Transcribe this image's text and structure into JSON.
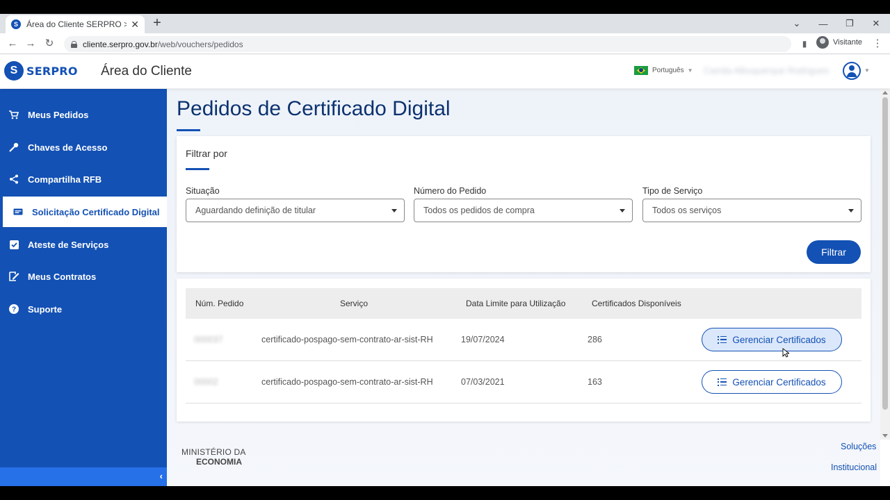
{
  "browser": {
    "tab_title": "Área do Cliente SERPRO > Pedidos",
    "url_host": "cliente.serpro.gov.br",
    "url_path": "/web/vouchers/pedidos",
    "profile_label": "Visitante"
  },
  "header": {
    "logo_mark": "S",
    "logo_text": "SERPRO",
    "app_title": "Área do Cliente",
    "language": "Português",
    "user_name": "Camila Albuquerque Rodrigues"
  },
  "sidebar": {
    "items": [
      {
        "label": "Meus Pedidos",
        "icon": "cart-icon"
      },
      {
        "label": "Chaves de Acesso",
        "icon": "key-icon"
      },
      {
        "label": "Compartilha RFB",
        "icon": "share-icon"
      },
      {
        "label": "Solicitação Certificado Digital",
        "icon": "certificate-icon",
        "active": true
      },
      {
        "label": "Ateste de Serviços",
        "icon": "check-square-icon"
      },
      {
        "label": "Meus Contratos",
        "icon": "contract-icon"
      },
      {
        "label": "Suporte",
        "icon": "help-icon"
      }
    ]
  },
  "main": {
    "page_title": "Pedidos de Certificado Digital",
    "filter": {
      "title": "Filtrar por",
      "fields": [
        {
          "label": "Situação",
          "value": "Aguardando definição de titular"
        },
        {
          "label": "Número do Pedido",
          "value": "Todos os pedidos de compra"
        },
        {
          "label": "Tipo de Serviço",
          "value": "Todos os serviços"
        }
      ],
      "button": "Filtrar"
    },
    "table": {
      "headers": [
        "Núm. Pedido",
        "Serviço",
        "Data Limite para Utilização",
        "Certificados Disponíveis"
      ],
      "rows": [
        {
          "pedido": "000037",
          "servico": "certificado-pospago-sem-contrato-ar-sist-RH",
          "data_limite": "19/07/2024",
          "disponiveis": "286",
          "action": "Gerenciar Certificados"
        },
        {
          "pedido": "00002",
          "servico": "certificado-pospago-sem-contrato-ar-sist-RH",
          "data_limite": "07/03/2021",
          "disponiveis": "163",
          "action": "Gerenciar Certificados"
        }
      ]
    }
  },
  "footer": {
    "logo_top": "MINISTÉRIO DA",
    "logo_bottom": "ECONOMIA",
    "links": [
      "Soluções",
      "Institucional"
    ]
  },
  "colors": {
    "brand_blue": "#1351b4",
    "title_navy": "#0c326f",
    "sidebar_footer": "#2670e8"
  }
}
